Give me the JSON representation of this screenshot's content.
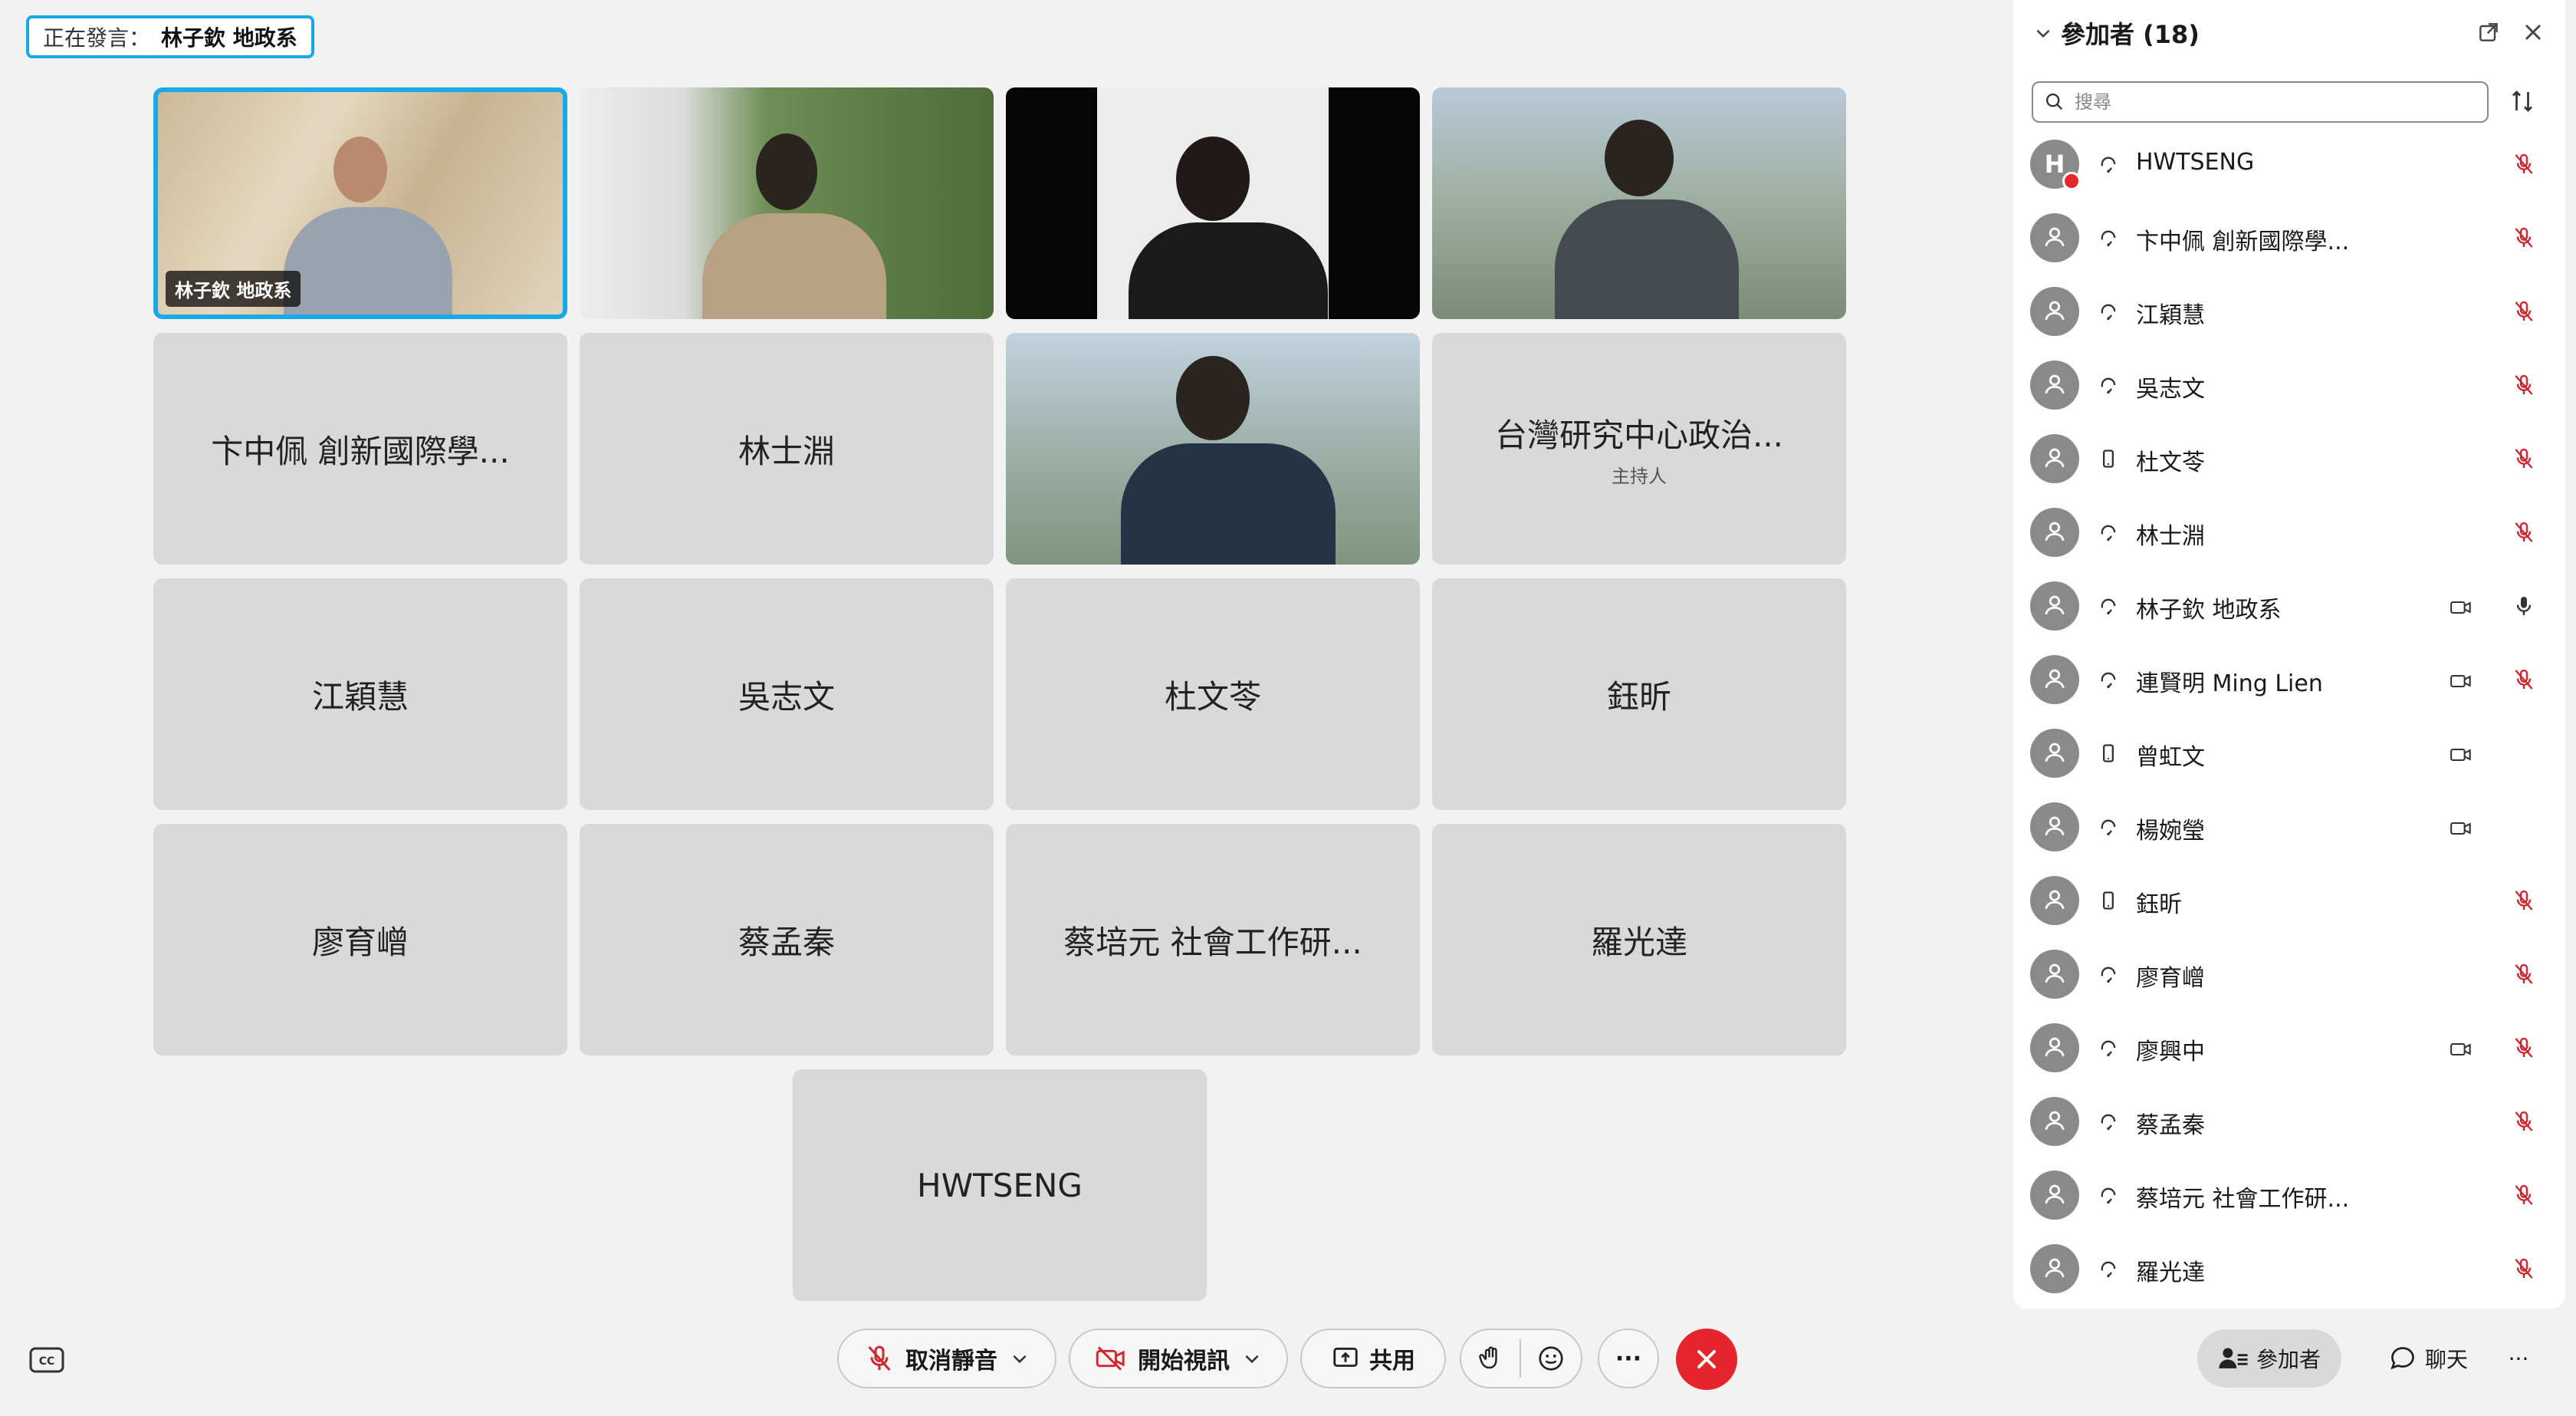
{
  "speaking": {
    "label": "正在發言：",
    "name": "林子欽 地政系"
  },
  "tiles": [
    {
      "name": "林子欽 地政系",
      "video": true,
      "active": true
    },
    {
      "name": "",
      "video": true
    },
    {
      "name": "",
      "video": true
    },
    {
      "name": "",
      "video": true
    },
    {
      "name": "卞中佩 創新國際學..."
    },
    {
      "name": "林士淵"
    },
    {
      "name": "",
      "video": true
    },
    {
      "name": "台灣研究中心政治...",
      "role": "主持人"
    },
    {
      "name": "江穎慧"
    },
    {
      "name": "吳志文"
    },
    {
      "name": "杜文苓"
    },
    {
      "name": "鈺昕"
    },
    {
      "name": "廖育嶒"
    },
    {
      "name": "蔡孟秦"
    },
    {
      "name": "蔡培元 社會工作研..."
    },
    {
      "name": "羅光達"
    },
    {
      "name": "HWTSENG"
    }
  ],
  "toolbar": {
    "unmute_label": "取消靜音",
    "start_video_label": "開始視訊",
    "share_label": "共用",
    "more_label": "···"
  },
  "panel": {
    "title": "參加者 (18)",
    "search_placeholder": "搜尋",
    "participants": [
      {
        "name": "HWTSENG",
        "initial": "H",
        "device": "headset",
        "camera": false,
        "mic": "muted"
      },
      {
        "name": "卞中佩 創新國際學...",
        "device": "headset",
        "camera": false,
        "mic": "muted"
      },
      {
        "name": "江穎慧",
        "device": "headset",
        "camera": false,
        "mic": "muted"
      },
      {
        "name": "吳志文",
        "device": "headset",
        "camera": false,
        "mic": "muted"
      },
      {
        "name": "杜文苓",
        "device": "phone",
        "camera": false,
        "mic": "muted"
      },
      {
        "name": "林士淵",
        "device": "headset",
        "camera": false,
        "mic": "muted"
      },
      {
        "name": "林子欽 地政系",
        "device": "headset",
        "camera": true,
        "mic": "on"
      },
      {
        "name": "連賢明 Ming Lien",
        "device": "headset",
        "camera": true,
        "mic": "muted"
      },
      {
        "name": "曾虹文",
        "device": "phone",
        "camera": true,
        "mic": "none"
      },
      {
        "name": "楊婉瑩",
        "device": "headset",
        "camera": true,
        "mic": "none"
      },
      {
        "name": "鈺昕",
        "device": "phone",
        "camera": false,
        "mic": "muted"
      },
      {
        "name": "廖育嶒",
        "device": "headset",
        "camera": false,
        "mic": "muted"
      },
      {
        "name": "廖興中",
        "device": "headset",
        "camera": true,
        "mic": "muted"
      },
      {
        "name": "蔡孟秦",
        "device": "headset",
        "camera": false,
        "mic": "muted"
      },
      {
        "name": "蔡培元 社會工作研...",
        "device": "headset",
        "camera": false,
        "mic": "muted"
      },
      {
        "name": "羅光達",
        "device": "headset",
        "camera": false,
        "mic": "muted"
      }
    ],
    "participants_button": "參加者",
    "chat_button": "聊天",
    "more_label": "···"
  },
  "colors": {
    "accent": "#1aa9e8",
    "end": "#e4262c",
    "muted": "#d0262f"
  }
}
